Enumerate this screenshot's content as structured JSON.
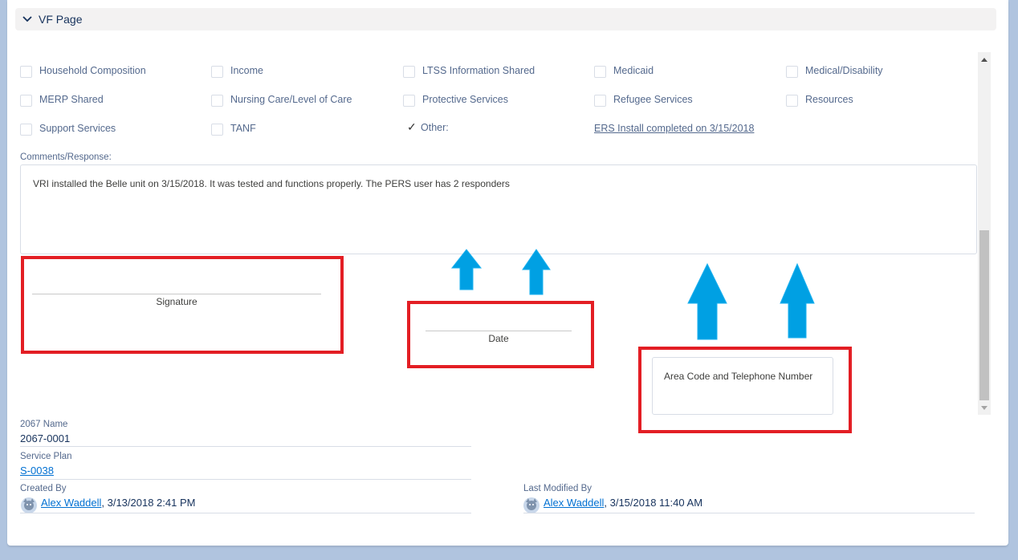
{
  "section": {
    "title": "VF Page"
  },
  "checkboxes": [
    {
      "label": "Household Composition",
      "checked": false
    },
    {
      "label": "Income",
      "checked": false
    },
    {
      "label": "LTSS Information Shared",
      "checked": false
    },
    {
      "label": "Medicaid",
      "checked": false
    },
    {
      "label": "Medical/Disability",
      "checked": false
    },
    {
      "label": "MERP Shared",
      "checked": false
    },
    {
      "label": "Nursing Care/Level of Care",
      "checked": false
    },
    {
      "label": "Protective Services",
      "checked": false
    },
    {
      "label": "Refugee Services",
      "checked": false
    },
    {
      "label": "Resources",
      "checked": false
    },
    {
      "label": "Support Services",
      "checked": false
    },
    {
      "label": "TANF",
      "checked": false
    },
    {
      "label": "Other:",
      "checked": true,
      "check_glyph": "✓"
    }
  ],
  "other_value": "ERS Install completed on 3/15/2018",
  "comments": {
    "label": "Comments/Response:",
    "text": "VRI installed the Belle unit on 3/15/2018. It was tested and functions properly. The PERS user has 2 responders"
  },
  "signature": {
    "label": "Signature"
  },
  "date": {
    "label": "Date"
  },
  "phone": {
    "label": "Area Code and Telephone Number"
  },
  "fields": {
    "name_label": "2067 Name",
    "name_value": "2067-0001",
    "service_plan_label": "Service Plan",
    "service_plan_value": "S-0038",
    "created_by_label": "Created By",
    "created_by_user": "Alex Waddell",
    "created_by_date": ", 3/13/2018 2:41 PM",
    "modified_by_label": "Last Modified By",
    "modified_by_user": "Alex Waddell",
    "modified_by_date": ", 3/15/2018 11:40 AM"
  },
  "colors": {
    "annotation_box": "#e31e24",
    "annotation_arrow": "#00a0e3",
    "link": "#0070d2",
    "page_background": "#b0c4df"
  },
  "icons": [
    "chevron-down-icon",
    "checkbox-icon",
    "checkmark-icon",
    "user-avatar-icon",
    "scroll-up-icon",
    "scroll-down-icon",
    "arrow-up-annotation-icon"
  ]
}
